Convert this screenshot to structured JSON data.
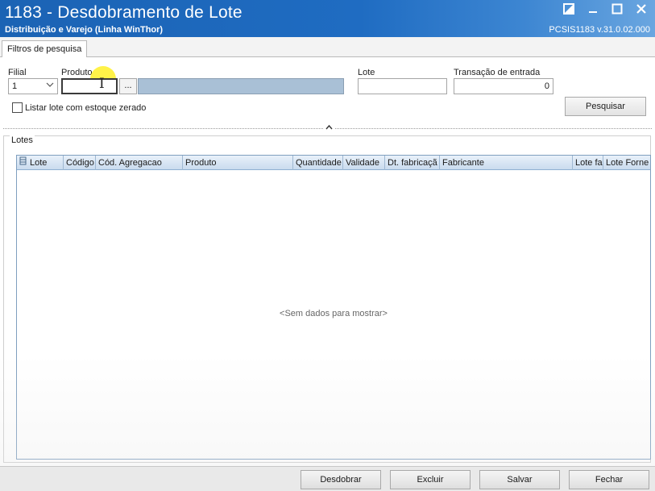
{
  "window": {
    "title": "1183 - Desdobramento de Lote",
    "subtitle": "Distribuição e Varejo (Linha WinThor)",
    "version": "PCSIS1183  v.31.0.02.000"
  },
  "tabs": [
    {
      "label": "Filtros de pesquisa",
      "active": true
    }
  ],
  "filters": {
    "filial": {
      "label": "Filial",
      "value": "1"
    },
    "produto": {
      "label": "Produto",
      "value": "",
      "lookup_button": "...",
      "description": ""
    },
    "lote": {
      "label": "Lote",
      "value": ""
    },
    "transacao": {
      "label": "Transação de entrada",
      "value": "0"
    },
    "listar_zerado": {
      "label": "Listar lote com estoque zerado",
      "checked": false
    },
    "search_button": "Pesquisar"
  },
  "lotes": {
    "group_label": "Lotes",
    "columns": [
      "Lote",
      "Código",
      "Cód. Agregacao",
      "Produto",
      "Quantidade",
      "Validade",
      "Dt. fabricaçã",
      "Fabricante",
      "Lote fa",
      "Lote Forne"
    ],
    "rows": [],
    "empty_message": "<Sem dados para mostrar>"
  },
  "footer": {
    "buttons": [
      "Desdobrar",
      "Excluir",
      "Salvar",
      "Fechar"
    ]
  },
  "colors": {
    "titlebar": "#1f6cc2",
    "grid_header": "#c9dbee",
    "description_field": "#a9c0d6",
    "cursor_highlight": "#fff028"
  },
  "icons": [
    "restore-icon",
    "minimize-icon",
    "maximize-icon",
    "close-icon",
    "chevron-down-icon",
    "column-chooser-icon",
    "collapse-caret-icon",
    "text-cursor-icon"
  ]
}
